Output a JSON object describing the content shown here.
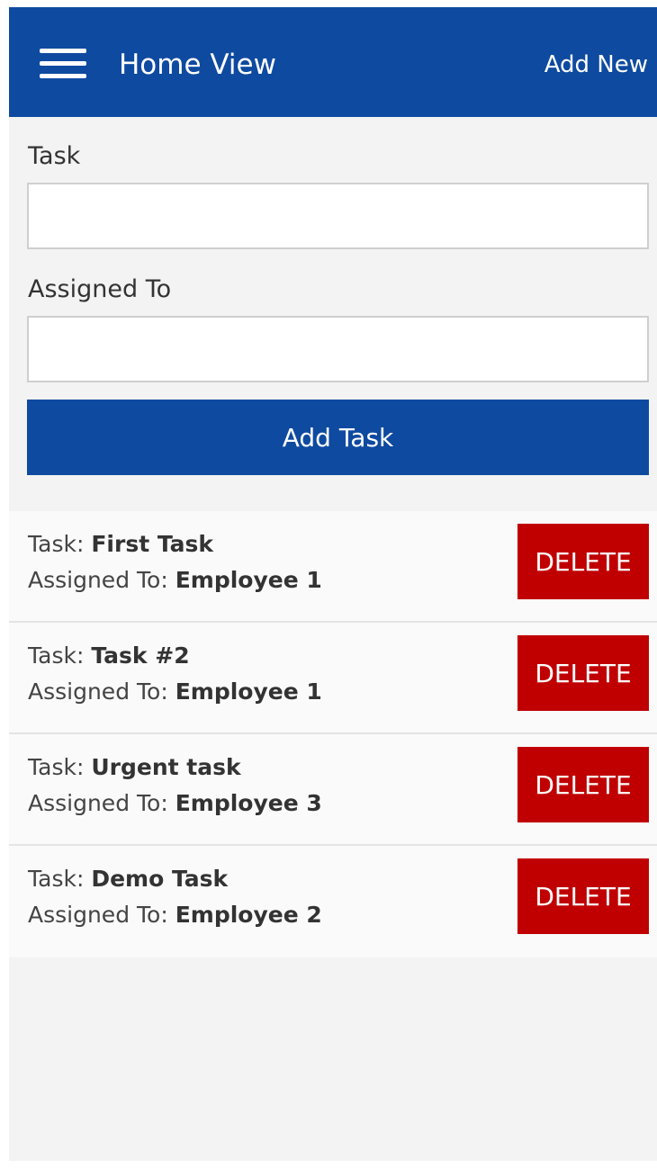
{
  "header": {
    "title": "Home View",
    "add_new_label": "Add New",
    "menu_icon": "hamburger-menu-icon"
  },
  "form": {
    "task_label": "Task",
    "task_value": "",
    "assigned_label": "Assigned To",
    "assigned_value": "",
    "add_button_label": "Add Task"
  },
  "tasks": [
    {
      "task_prefix": "Task:",
      "task": "First Task",
      "assigned_prefix": "Assigned To:",
      "assigned": "Employee 1",
      "delete_label": "DELETE"
    },
    {
      "task_prefix": "Task:",
      "task": "Task #2",
      "assigned_prefix": "Assigned To:",
      "assigned": "Employee 1",
      "delete_label": "DELETE"
    },
    {
      "task_prefix": "Task:",
      "task": "Urgent task",
      "assigned_prefix": "Assigned To:",
      "assigned": "Employee 3",
      "delete_label": "DELETE"
    },
    {
      "task_prefix": "Task:",
      "task": "Demo Task",
      "assigned_prefix": "Assigned To:",
      "assigned": "Employee 2",
      "delete_label": "DELETE"
    }
  ],
  "colors": {
    "primary": "#0e4aa0",
    "danger": "#c00000",
    "background": "#f3f3f3"
  }
}
